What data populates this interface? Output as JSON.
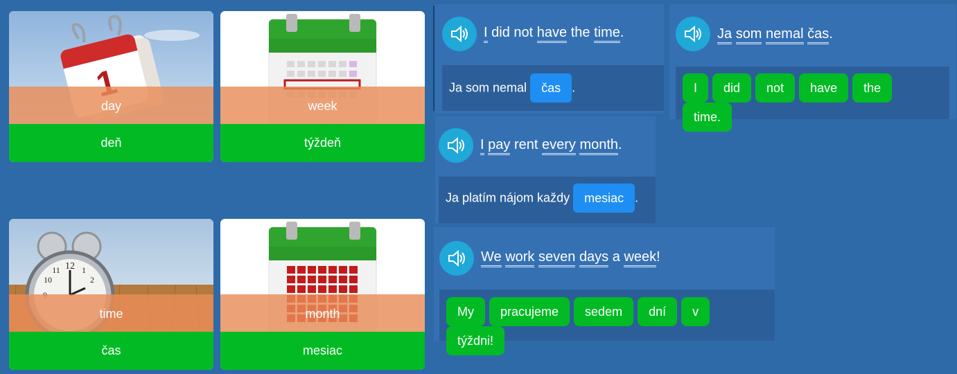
{
  "flashcards": [
    {
      "word": "day",
      "translation": "deň",
      "image": "tear-off-calendar-image"
    },
    {
      "word": "week",
      "translation": "týždeň",
      "image": "calendar-week-image"
    },
    {
      "word": "time",
      "translation": "čas",
      "image": "alarm-clock-image"
    },
    {
      "word": "month",
      "translation": "mesiac",
      "image": "calendar-month-image"
    }
  ],
  "calendar_day_number": "1",
  "clock_numbers": [
    "12",
    "11",
    "10",
    "9",
    "1",
    "2"
  ],
  "exercises": [
    {
      "sentence_words": [
        "I",
        "did",
        "not",
        "have",
        "the",
        "time"
      ],
      "sentence_end": ".",
      "answer_prefix": "Ja som nemal",
      "answer_chip": "čas",
      "answer_suffix": "."
    },
    {
      "sentence_words": [
        "Ja",
        "som",
        "nemal",
        "čas"
      ],
      "sentence_end": ".",
      "chips": [
        "I",
        "did",
        "not",
        "have",
        "the",
        "time."
      ]
    },
    {
      "sentence_words": [
        "I",
        "pay",
        "rent",
        "every",
        "month"
      ],
      "sentence_end": ".",
      "answer_prefix": "Ja platím nájom každy",
      "answer_chip": "mesiac",
      "answer_suffix": "."
    },
    {
      "sentence_words": [
        "We",
        "work",
        "seven",
        "days",
        "a",
        "week"
      ],
      "sentence_end": "!",
      "chips": [
        "My",
        "pracujeme",
        "sedem",
        "dní",
        "v",
        "týždni!"
      ]
    }
  ],
  "colors": {
    "background": "#2e6aa8",
    "panel": "#3570b3",
    "answer_area": "#2c5f99",
    "green": "#02bb24",
    "blue_chip": "#1f8ef2",
    "speaker": "#1fa8d8",
    "band": "#e98c58"
  }
}
